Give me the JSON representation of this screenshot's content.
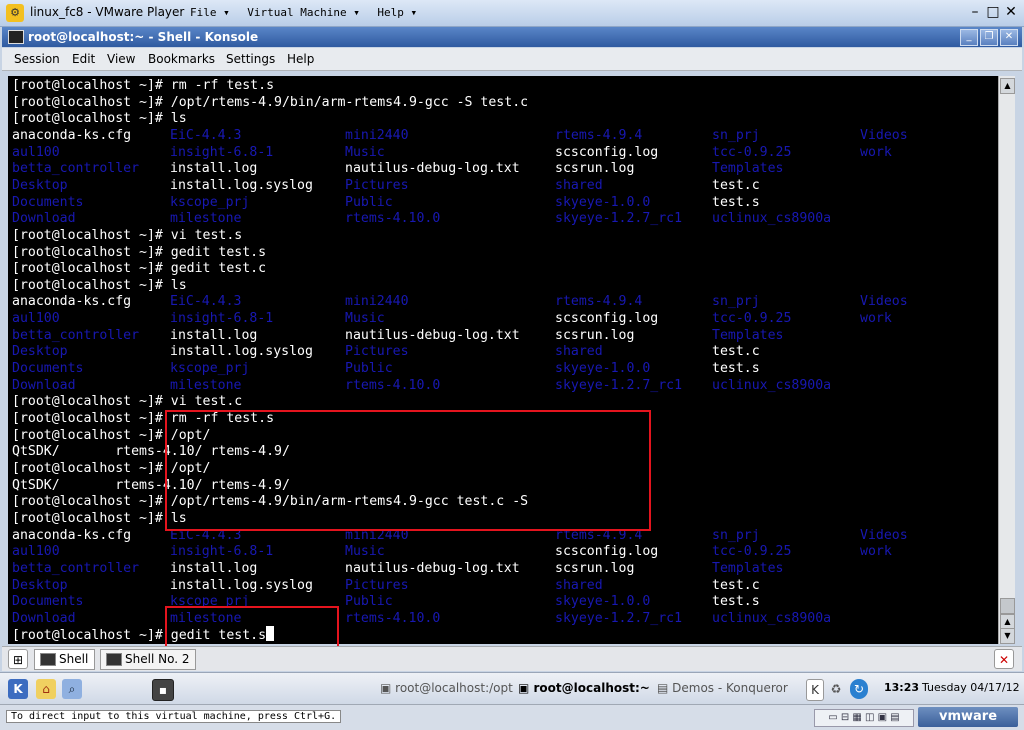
{
  "vm_window": {
    "title": "linux_fc8 - VMware Player",
    "menus": [
      "File ▾",
      "Virtual Machine ▾",
      "Help ▾"
    ]
  },
  "konsole": {
    "title": "root@localhost:~ - Shell - Konsole",
    "menu": [
      "Session",
      "Edit",
      "View",
      "Bookmarks",
      "Settings",
      "Help"
    ],
    "tabs": [
      "Shell",
      "Shell No. 2"
    ]
  },
  "terminal": {
    "lines": [
      {
        "text": "[root@localhost ~]# rm -rf test.s"
      },
      {
        "text": "[root@localhost ~]# /opt/rtems-4.9/bin/arm-rtems4.9-gcc -S test.c"
      },
      {
        "text": "[root@localhost ~]# ls"
      },
      {
        "cols": [
          "anaconda-ks.cfg",
          "EiC-4.4.3",
          "mini2440",
          "rtems-4.9.4",
          "sn_prj",
          "Videos"
        ],
        "blue": [
          0,
          1,
          1,
          1,
          1,
          1
        ]
      },
      {
        "cols": [
          "aul100",
          "insight-6.8-1",
          "Music",
          "scsconfig.log",
          "tcc-0.9.25",
          "work"
        ],
        "blue": [
          1,
          1,
          1,
          0,
          1,
          1
        ]
      },
      {
        "cols": [
          "betta_controller",
          "install.log",
          "nautilus-debug-log.txt",
          "scsrun.log",
          "Templates",
          ""
        ],
        "blue": [
          1,
          0,
          0,
          0,
          1,
          0
        ]
      },
      {
        "cols": [
          "Desktop",
          "install.log.syslog",
          "Pictures",
          "shared",
          "test.c",
          ""
        ],
        "blue": [
          1,
          0,
          1,
          1,
          0,
          0
        ]
      },
      {
        "cols": [
          "Documents",
          "kscope_prj",
          "Public",
          "skyeye-1.0.0",
          "test.s",
          ""
        ],
        "blue": [
          1,
          1,
          1,
          1,
          0,
          0
        ]
      },
      {
        "cols": [
          "Download",
          "milestone",
          "rtems-4.10.0",
          "skyeye-1.2.7_rc1",
          "uclinux_cs8900a",
          ""
        ],
        "blue": [
          1,
          1,
          1,
          1,
          1,
          0
        ]
      },
      {
        "text": "[root@localhost ~]# vi test.s"
      },
      {
        "text": "[root@localhost ~]# gedit test.s"
      },
      {
        "text": "[root@localhost ~]# gedit test.c"
      },
      {
        "text": "[root@localhost ~]# ls"
      },
      {
        "cols": [
          "anaconda-ks.cfg",
          "EiC-4.4.3",
          "mini2440",
          "rtems-4.9.4",
          "sn_prj",
          "Videos"
        ],
        "blue": [
          0,
          1,
          1,
          1,
          1,
          1
        ]
      },
      {
        "cols": [
          "aul100",
          "insight-6.8-1",
          "Music",
          "scsconfig.log",
          "tcc-0.9.25",
          "work"
        ],
        "blue": [
          1,
          1,
          1,
          0,
          1,
          1
        ]
      },
      {
        "cols": [
          "betta_controller",
          "install.log",
          "nautilus-debug-log.txt",
          "scsrun.log",
          "Templates",
          ""
        ],
        "blue": [
          1,
          0,
          0,
          0,
          1,
          0
        ]
      },
      {
        "cols": [
          "Desktop",
          "install.log.syslog",
          "Pictures",
          "shared",
          "test.c",
          ""
        ],
        "blue": [
          1,
          0,
          1,
          1,
          0,
          0
        ]
      },
      {
        "cols": [
          "Documents",
          "kscope_prj",
          "Public",
          "skyeye-1.0.0",
          "test.s",
          ""
        ],
        "blue": [
          1,
          1,
          1,
          1,
          0,
          0
        ]
      },
      {
        "cols": [
          "Download",
          "milestone",
          "rtems-4.10.0",
          "skyeye-1.2.7_rc1",
          "uclinux_cs8900a",
          ""
        ],
        "blue": [
          1,
          1,
          1,
          1,
          1,
          0
        ]
      },
      {
        "text": "[root@localhost ~]# vi test.c"
      },
      {
        "text": "[root@localhost ~]# rm -rf test.s"
      },
      {
        "text": "[root@localhost ~]# /opt/"
      },
      {
        "text": "QtSDK/       rtems-4.10/ rtems-4.9/"
      },
      {
        "text": "[root@localhost ~]# /opt/"
      },
      {
        "text": "QtSDK/       rtems-4.10/ rtems-4.9/"
      },
      {
        "text": "[root@localhost ~]# /opt/rtems-4.9/bin/arm-rtems4.9-gcc test.c -S"
      },
      {
        "text": "[root@localhost ~]# ls"
      },
      {
        "cols": [
          "anaconda-ks.cfg",
          "EiC-4.4.3",
          "mini2440",
          "rtems-4.9.4",
          "sn_prj",
          "Videos"
        ],
        "blue": [
          0,
          1,
          1,
          1,
          1,
          1
        ]
      },
      {
        "cols": [
          "aul100",
          "insight-6.8-1",
          "Music",
          "scsconfig.log",
          "tcc-0.9.25",
          "work"
        ],
        "blue": [
          1,
          1,
          1,
          0,
          1,
          1
        ]
      },
      {
        "cols": [
          "betta_controller",
          "install.log",
          "nautilus-debug-log.txt",
          "scsrun.log",
          "Templates",
          ""
        ],
        "blue": [
          1,
          0,
          0,
          0,
          1,
          0
        ]
      },
      {
        "cols": [
          "Desktop",
          "install.log.syslog",
          "Pictures",
          "shared",
          "test.c",
          ""
        ],
        "blue": [
          1,
          0,
          1,
          1,
          0,
          0
        ]
      },
      {
        "cols": [
          "Documents",
          "kscope_prj",
          "Public",
          "skyeye-1.0.0",
          "test.s",
          ""
        ],
        "blue": [
          1,
          1,
          1,
          1,
          0,
          0
        ]
      },
      {
        "cols": [
          "Download",
          "milestone",
          "rtems-4.10.0",
          "skyeye-1.2.7_rc1",
          "uclinux_cs8900a",
          ""
        ],
        "blue": [
          1,
          1,
          1,
          1,
          1,
          0
        ]
      },
      {
        "text": "[root@localhost ~]# gedit test.s",
        "cursor": true
      }
    ]
  },
  "taskbar": {
    "tasks": [
      "root@localhost:/opt",
      "root@localhost:~",
      "Demos - Konqueror"
    ],
    "clock_time": "13:23",
    "clock_date": "Tuesday 04/17/12"
  },
  "statusbar": {
    "message": "To direct input to this virtual machine, press Ctrl+G.",
    "brand": "vmware"
  },
  "colors": {
    "terminal_bg": "#000000",
    "terminal_fg": "#ffffff",
    "dir_blue": "#1818b2",
    "highlight_red": "#e4141e"
  }
}
